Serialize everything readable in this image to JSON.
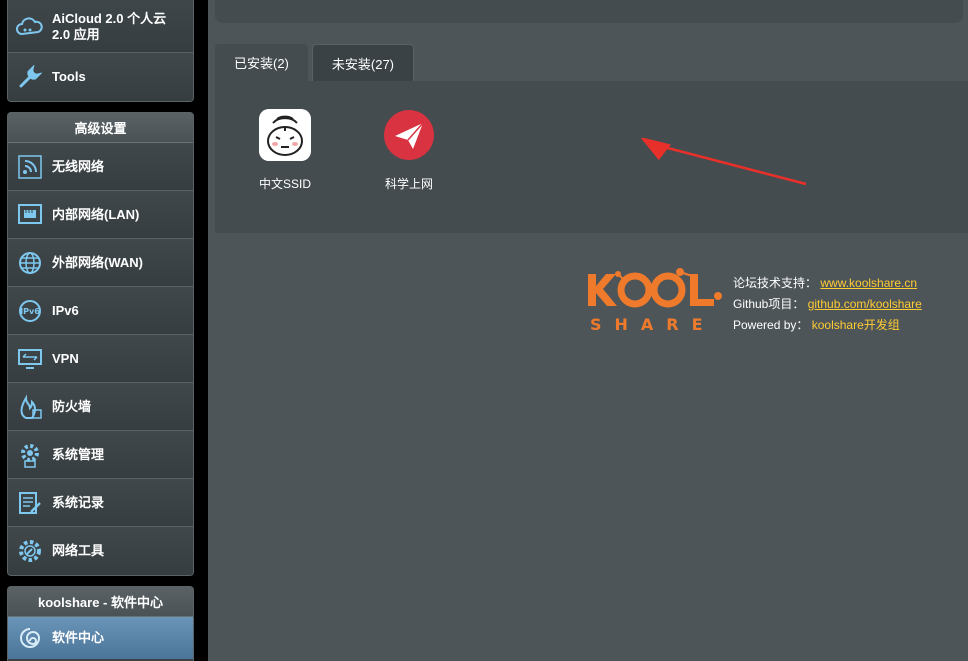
{
  "sidebar": {
    "top_items": [
      {
        "label": "AiCloud 2.0 个人云 2.0 应用",
        "icon": "cloud-icon"
      },
      {
        "label": "Tools",
        "icon": "wrench-icon"
      }
    ],
    "advanced": {
      "header": "高级设置",
      "items": [
        {
          "label": "无线网络",
          "icon": "wireless-icon"
        },
        {
          "label": "内部网络(LAN)",
          "icon": "lan-icon"
        },
        {
          "label": "外部网络(WAN)",
          "icon": "globe-icon"
        },
        {
          "label": "IPv6",
          "icon": "ipv6-icon"
        },
        {
          "label": "VPN",
          "icon": "vpn-icon"
        },
        {
          "label": "防火墙",
          "icon": "firewall-icon"
        },
        {
          "label": "系统管理",
          "icon": "gear-icon"
        },
        {
          "label": "系统记录",
          "icon": "log-icon"
        },
        {
          "label": "网络工具",
          "icon": "network-tools-icon"
        }
      ]
    },
    "softcenter": {
      "header": "koolshare - 软件中心",
      "items": [
        {
          "label": "软件中心",
          "icon": "swirl-icon"
        }
      ]
    }
  },
  "tabs": {
    "installed": "已安装(2)",
    "not_installed": "未安装(27)"
  },
  "apps": [
    {
      "label": "中文SSID",
      "icon": "robot-face-icon"
    },
    {
      "label": "科学上网",
      "icon": "paper-plane-icon"
    }
  ],
  "footer": {
    "forum_label": "论坛技术支持：",
    "forum_link": "www.koolshare.cn",
    "github_label": "Github项目：",
    "github_link": "github.com/koolshare",
    "powered_label": "Powered by：",
    "powered_value": "koolshare开发组",
    "logo_top": "KOOL",
    "logo_bottom": "SHARE"
  },
  "colors": {
    "accent_orange": "#f07a2c",
    "link_yellow": "#ffcc33",
    "arrow_red": "#e8302a"
  }
}
